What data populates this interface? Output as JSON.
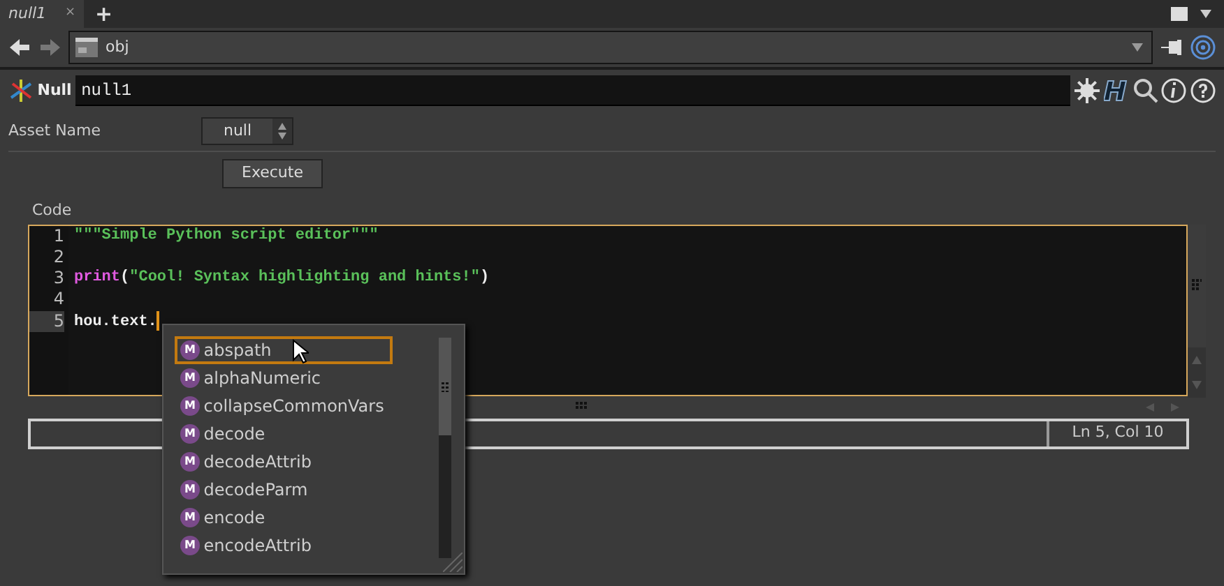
{
  "tabs": [
    {
      "label": "null1",
      "selected": true,
      "close": "×"
    }
  ],
  "new_tab": "+",
  "path_bar": {
    "value": "obj"
  },
  "node": {
    "type": "Null",
    "name": "null1"
  },
  "parameters": {
    "asset_name": {
      "label": "Asset Name",
      "value": "null"
    },
    "execute": "Execute"
  },
  "code": {
    "label": "Code",
    "lines": [
      {
        "number": "1",
        "current": false,
        "tokens": [
          {
            "kind": "string",
            "text": "\"\"\"Simple Python script editor\"\"\""
          }
        ]
      },
      {
        "number": "2",
        "current": false
      },
      {
        "number": "3",
        "current": false,
        "tokens": [
          {
            "kind": "keyword",
            "text": "print"
          },
          {
            "kind": "plain",
            "text": "("
          },
          {
            "kind": "string",
            "text": "\"Cool! Syntax highlighting and hints!\""
          },
          {
            "kind": "plain",
            "text": ")"
          }
        ]
      },
      {
        "number": "4",
        "current": false
      },
      {
        "number": "5",
        "current": true,
        "tokens": [
          {
            "kind": "plain",
            "text": "hou.text."
          }
        ]
      }
    ]
  },
  "completions": [
    {
      "badge": "M",
      "label": "abspath",
      "selected": true
    },
    {
      "badge": "M",
      "label": "alphaNumeric",
      "selected": false
    },
    {
      "badge": "M",
      "label": "collapseCommonVars",
      "selected": false
    },
    {
      "badge": "M",
      "label": "decode",
      "selected": false
    },
    {
      "badge": "M",
      "label": "decodeAttrib",
      "selected": false
    },
    {
      "badge": "M",
      "label": "decodeParm",
      "selected": false
    },
    {
      "badge": "M",
      "label": "encode",
      "selected": false
    },
    {
      "badge": "M",
      "label": "encodeAttrib",
      "selected": false
    }
  ],
  "status_bar": {
    "position": "Ln 5, Col 10"
  }
}
